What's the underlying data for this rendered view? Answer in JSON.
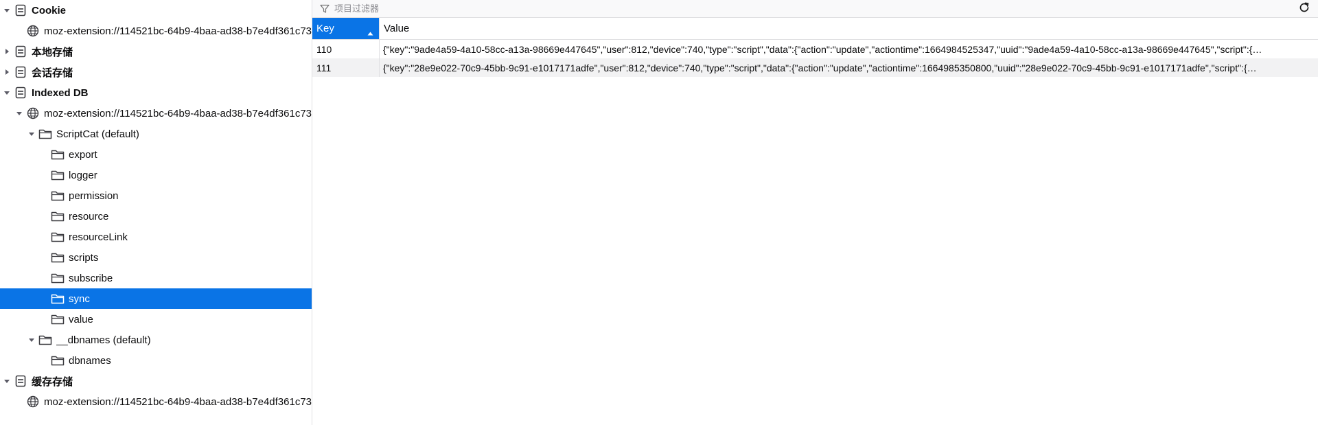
{
  "sidebar": {
    "cookie": {
      "label": "Cookie",
      "child": "moz-extension://114521bc-64b9-4baa-ad38-b7e4df361c73"
    },
    "local_storage": {
      "label": "本地存储"
    },
    "session_storage": {
      "label": "会话存储"
    },
    "indexed_db": {
      "label": "Indexed DB",
      "origin": "moz-extension://114521bc-64b9-4baa-ad38-b7e4df361c73",
      "db1": {
        "label": "ScriptCat (default)",
        "stores": [
          "export",
          "logger",
          "permission",
          "resource",
          "resourceLink",
          "scripts",
          "subscribe",
          "sync",
          "value"
        ],
        "selected": "sync"
      },
      "db2": {
        "label": "__dbnames (default)",
        "stores": [
          "dbnames"
        ]
      }
    },
    "cache_storage": {
      "label": "缓存存储",
      "child": "moz-extension://114521bc-64b9-4baa-ad38-b7e4df361c73"
    }
  },
  "toolbar": {
    "filter_placeholder": "项目过滤器"
  },
  "table": {
    "headers": {
      "key": "Key",
      "value": "Value"
    },
    "rows": [
      {
        "key": "110",
        "value": "{\"key\":\"9ade4a59-4a10-58cc-a13a-98669e447645\",\"user\":812,\"device\":740,\"type\":\"script\",\"data\":{\"action\":\"update\",\"actiontime\":1664984525347,\"uuid\":\"9ade4a59-4a10-58cc-a13a-98669e447645\",\"script\":{…"
      },
      {
        "key": "111",
        "value": "{\"key\":\"28e9e022-70c9-45bb-9c91-e1017171adfe\",\"user\":812,\"device\":740,\"type\":\"script\",\"data\":{\"action\":\"update\",\"actiontime\":1664985350800,\"uuid\":\"28e9e022-70c9-45bb-9c91-e1017171adfe\",\"script\":{…"
      }
    ]
  },
  "colors": {
    "selection": "#0a74e6",
    "border": "#e0e0e2",
    "alt_row": "#f2f2f3"
  },
  "icons": {
    "storage": "storage-icon",
    "globe": "globe-icon",
    "folder": "folder-icon",
    "filter": "filter-icon",
    "refresh": "refresh-icon",
    "expand": "expand-arrow-icon",
    "collapse": "collapse-arrow-icon"
  }
}
